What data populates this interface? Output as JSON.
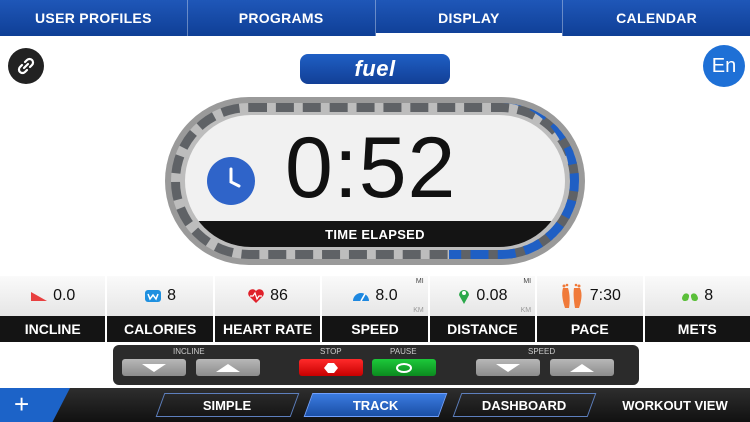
{
  "topnav": {
    "tabs": [
      {
        "label": "USER PROFILES"
      },
      {
        "label": "PROGRAMS"
      },
      {
        "label": "DISPLAY"
      },
      {
        "label": "CALENDAR"
      }
    ],
    "active_tab": "DISPLAY"
  },
  "header": {
    "brand": "fuel",
    "language": "En"
  },
  "timer": {
    "value": "0:52",
    "label": "TIME ELAPSED"
  },
  "metrics": [
    {
      "icon": "incline-icon",
      "value": "0.0",
      "label": "INCLINE",
      "unit_top": "",
      "unit_bottom": ""
    },
    {
      "icon": "calories-icon",
      "value": "8",
      "label": "CALORIES",
      "unit_top": "",
      "unit_bottom": ""
    },
    {
      "icon": "heart-rate-icon",
      "value": "86",
      "label": "HEART RATE",
      "unit_top": "",
      "unit_bottom": ""
    },
    {
      "icon": "speed-icon",
      "value": "8.0",
      "label": "SPEED",
      "unit_top": "MI",
      "unit_bottom": "KM"
    },
    {
      "icon": "distance-icon",
      "value": "0.08",
      "label": "DISTANCE",
      "unit_top": "MI",
      "unit_bottom": "KM"
    },
    {
      "icon": "pace-icon",
      "value": "7:30",
      "label": "PACE",
      "unit_top": "",
      "unit_bottom": ""
    },
    {
      "icon": "mets-icon",
      "value": "8",
      "label": "METS",
      "unit_top": "",
      "unit_bottom": ""
    }
  ],
  "controls": {
    "incline_label": "INCLINE",
    "stop_label": "STOP",
    "pause_label": "PAUSE",
    "speed_label": "SPEED"
  },
  "bottombar": {
    "simple": "SIMPLE",
    "track": "TRACK",
    "dashboard": "DASHBOARD",
    "workout_view": "WORKOUT VIEW",
    "active": "TRACK"
  },
  "colors": {
    "primary_blue": "#1f5fc4",
    "stop_red": "#e00000",
    "pause_green": "#16a82c"
  }
}
